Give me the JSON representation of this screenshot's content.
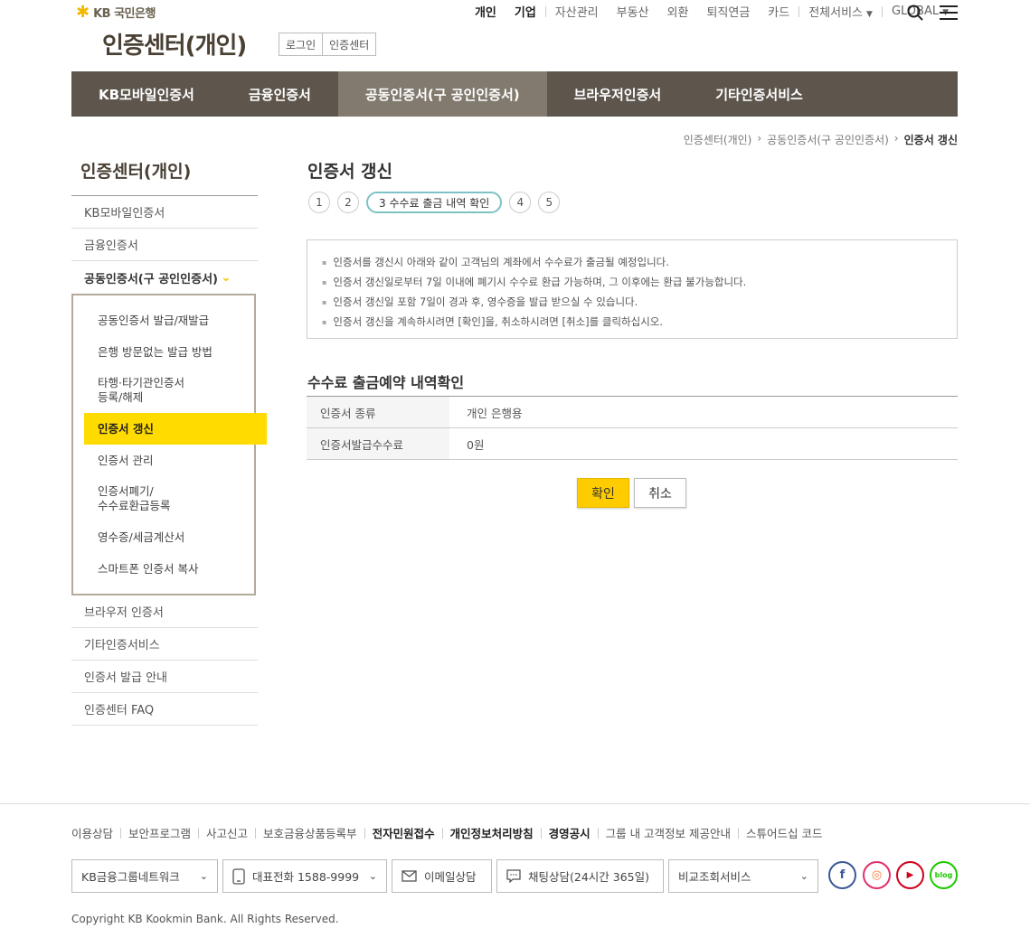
{
  "header": {
    "logo_text": "KB 국민은행",
    "site_title": "인증센터(개인)",
    "login_label": "로그인",
    "cert_center_label": "인증센터",
    "topnav": [
      "개인",
      "기업",
      "자산관리",
      "부동산",
      "외환",
      "퇴직연금",
      "카드",
      "전체서비스",
      "GLOBAL"
    ]
  },
  "mainnav": [
    "KB모바일인증서",
    "금융인증서",
    "공동인증서(구 공인인증서)",
    "브라우저인증서",
    "기타인증서비스"
  ],
  "breadcrumb": [
    "인증센터(개인)",
    "공동인증서(구 공인인증서)",
    "인증서 갱신"
  ],
  "sidebar": {
    "title": "인증센터(개인)",
    "items_top": [
      "KB모바일인증서",
      "금융인증서"
    ],
    "open_item": "공동인증서(구 공인인증서)",
    "submenu": [
      "공동인증서 발급/재발급",
      "은행 방문없는 발급 방법",
      "타행·타기관인증서\n등록/해제",
      "인증서 갱신",
      "인증서 관리",
      "인증서폐기/\n수수료환급등록",
      "영수증/세금계산서",
      "스마트폰 인증서 복사"
    ],
    "items_bottom": [
      "브라우저 인증서",
      "기타인증서비스",
      "인증서 발급 안내",
      "인증센터 FAQ"
    ]
  },
  "content": {
    "title": "인증서 갱신",
    "steps": [
      "1",
      "2",
      "3 수수료 출금 내역 확인",
      "4",
      "5"
    ],
    "notices": [
      "인증서를 갱신시 아래와 같이 고객님의 계좌에서 수수료가 출금될 예정입니다.",
      "인증서 갱신일로부터 7일 이내에 폐기시 수수료 환급 가능하며, 그 이후에는 환급 불가능합니다.",
      "인증서 갱신일 포함 7일이 경과 후, 영수증을 발급 받으실 수 있습니다.",
      "인증서 갱신을 계속하시려면 [확인]을, 취소하시려면 [취소]를 클릭하십시오."
    ],
    "section_title": "수수료 출금예약 내역확인",
    "table": [
      {
        "label": "인증서 종류",
        "value": "개인 은행용"
      },
      {
        "label": "인증서발급수수료",
        "value": "0원"
      }
    ],
    "ok_label": "확인",
    "cancel_label": "취소"
  },
  "footer": {
    "links": [
      "이용상담",
      "보안프로그램",
      "사고신고",
      "보호금융상품등록부",
      "전자민원접수",
      "개인정보처리방침",
      "경영공시",
      "그룹 내 고객정보 제공안내",
      "스튜어드십 코드"
    ],
    "network_label": "KB금융그룹네트워크",
    "phone_label": "대표전화 1588-9999",
    "email_label": "이메일상담",
    "chat_label": "채팅상담(24시간 365일)",
    "compare_label": "비교조회서비스",
    "blog_label": "blog",
    "copyright": "Copyright KB Kookmin Bank. All Rights Reserved."
  }
}
